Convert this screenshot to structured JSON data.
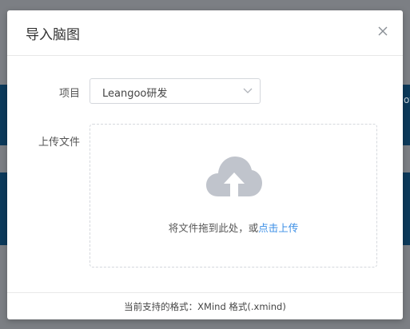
{
  "background": {
    "right_edge_text": "ot"
  },
  "dialog": {
    "title": "导入脑图",
    "close_icon": "close-icon",
    "form": {
      "project_label": "项目",
      "project_value": "Leangoo研发",
      "upload_label": "上传文件",
      "drop_text": "将文件拖到此处，或",
      "drop_link": "点击上传"
    },
    "footer_text": "当前支持的格式：XMind 格式(.xmind)"
  },
  "colors": {
    "overlay": "#7c7f84",
    "background_band": "#0c3a5b",
    "link": "#3a8ee6",
    "cloud_icon": "#c0c4cc"
  }
}
